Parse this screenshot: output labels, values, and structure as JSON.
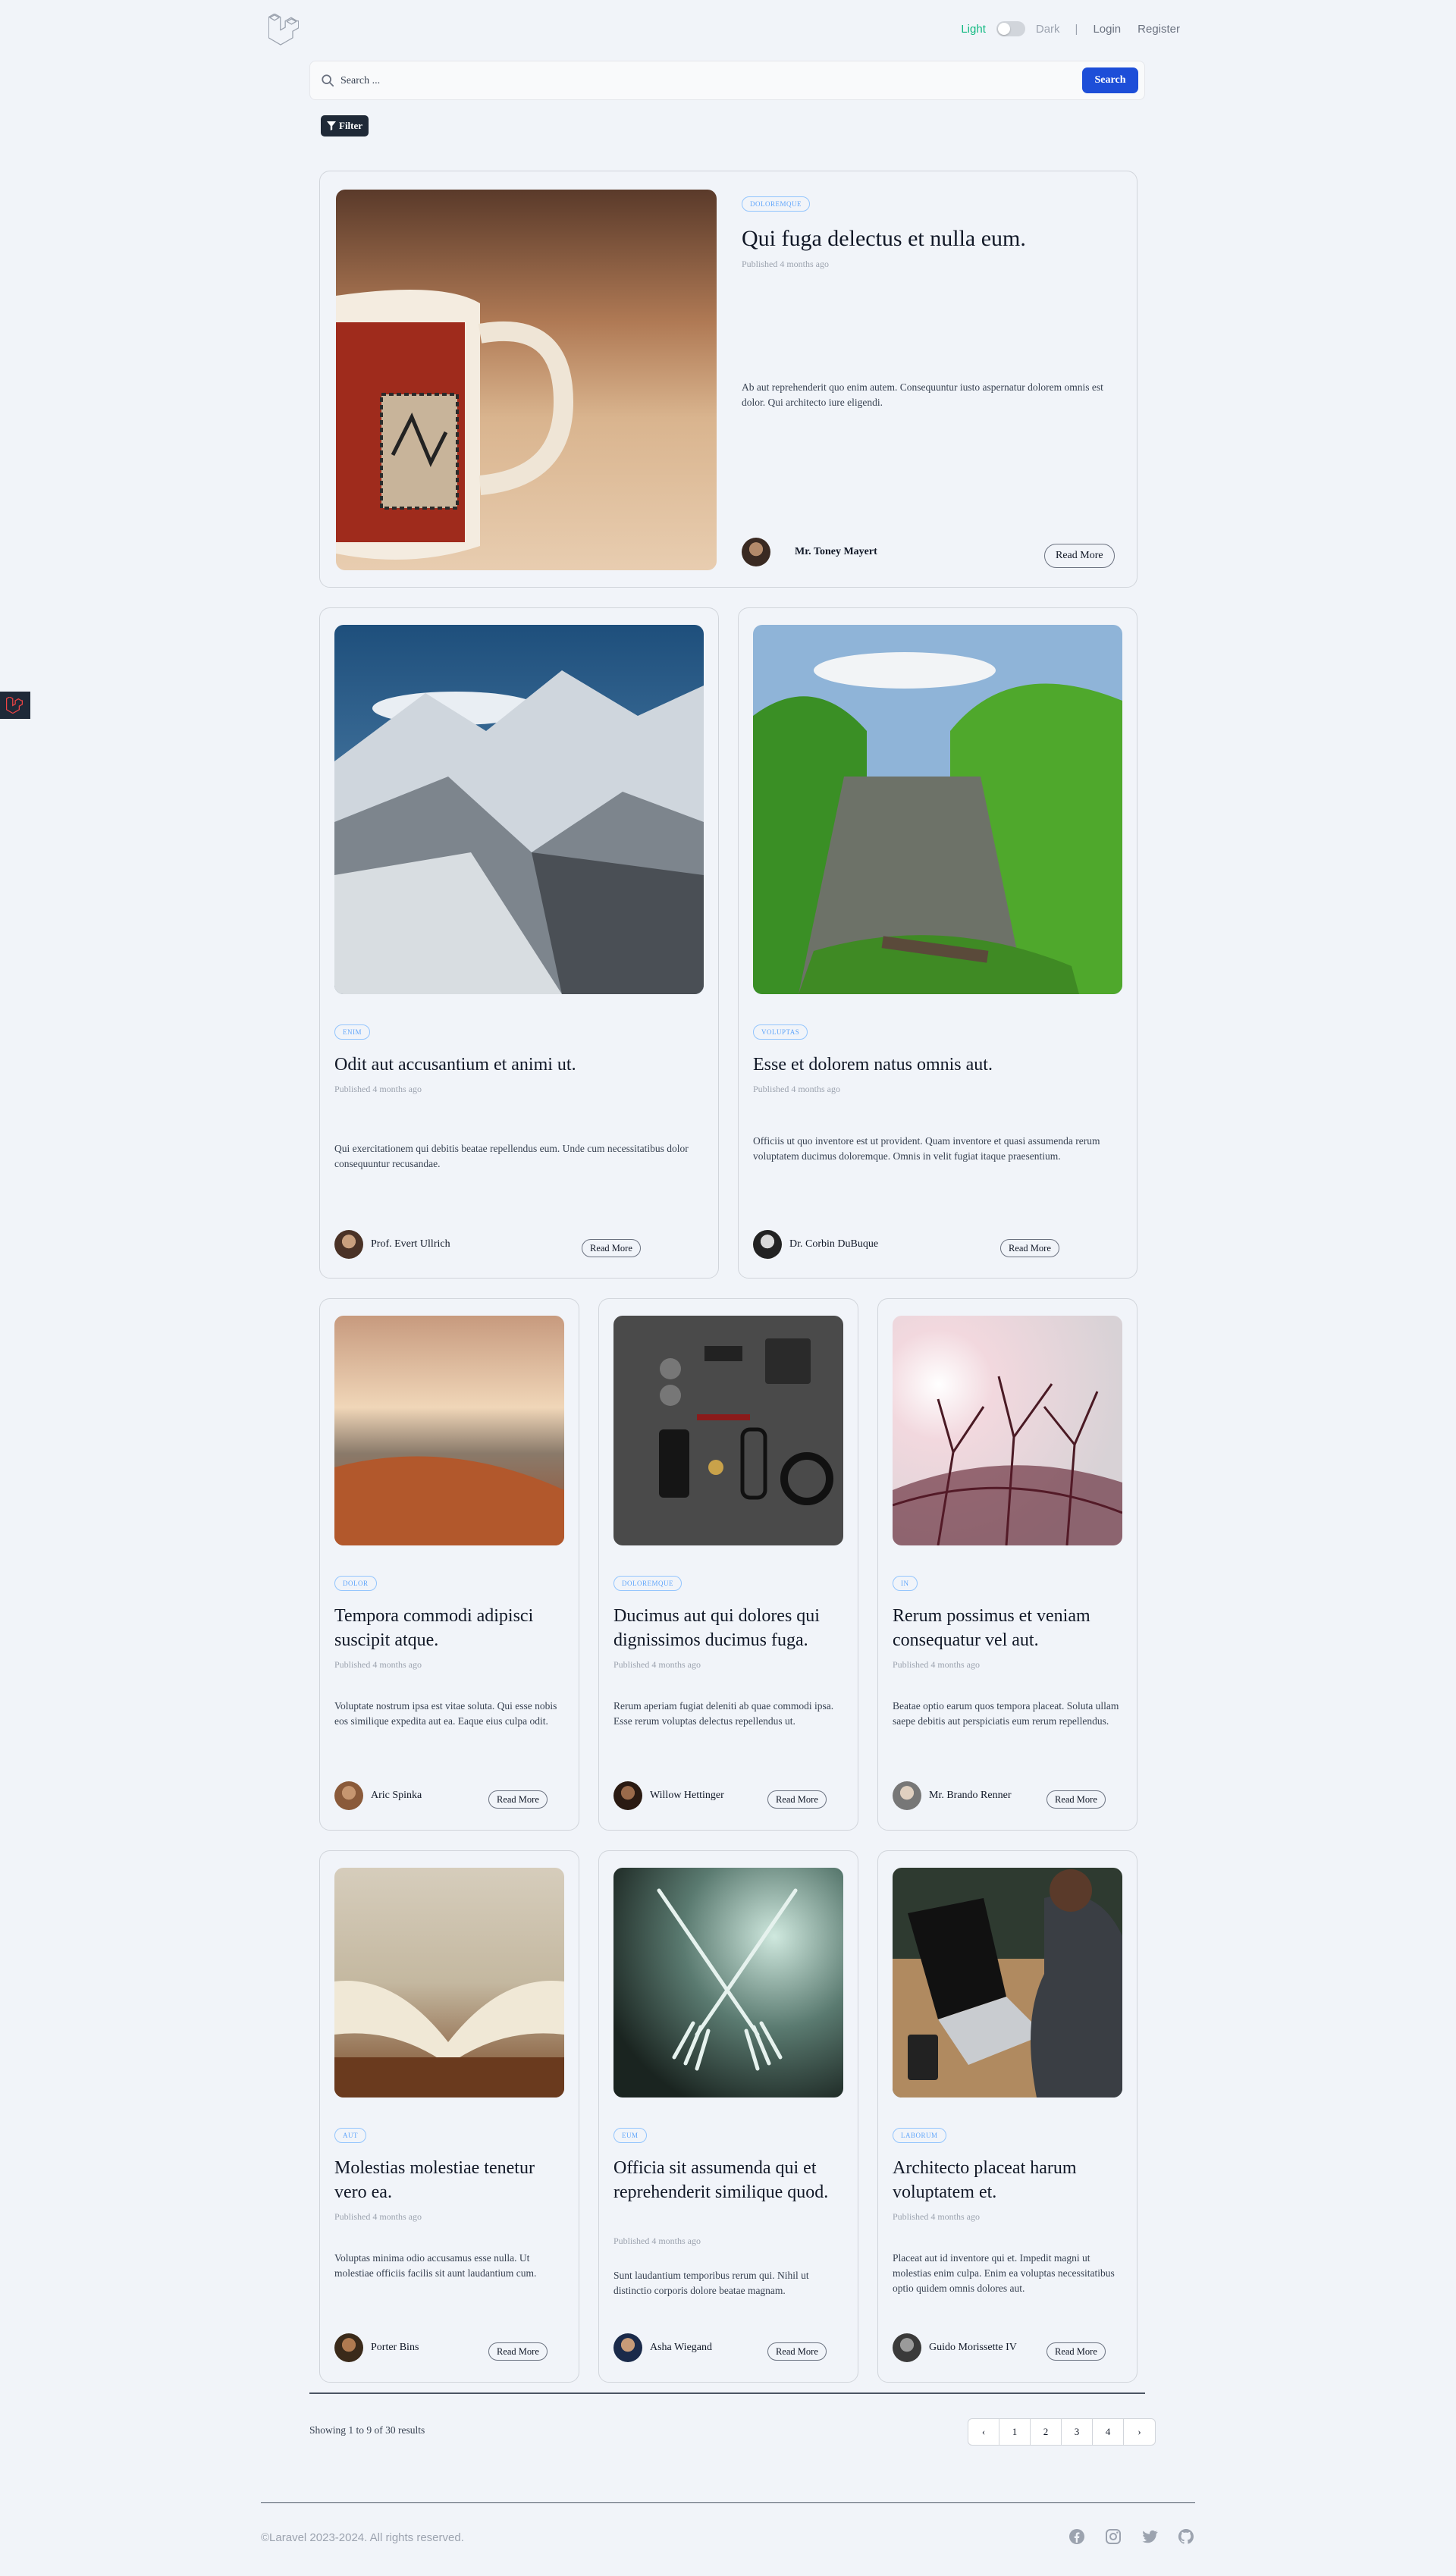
{
  "nav": {
    "light": "Light",
    "dark": "Dark",
    "separator": "|",
    "login": "Login",
    "register": "Register"
  },
  "search": {
    "placeholder": "Search ...",
    "button": "Search"
  },
  "filter": {
    "label": "Filter"
  },
  "posts": [
    {
      "tag": "DOLOREMQUE",
      "title": "Qui fuga delectus et nulla eum.",
      "published": "Published 4 months ago",
      "excerpt": "Ab aut reprehenderit quo enim autem. Consequuntur iusto aspernatur dolorem omnis est dolor. Qui architecto iure eligendi.",
      "author": "Mr. Toney Mayert",
      "read_more": "Read More"
    },
    {
      "tag": "ENIM",
      "title": "Odit aut accusantium et animi ut.",
      "published": "Published 4 months ago",
      "excerpt": "Qui exercitationem qui debitis beatae repellendus eum. Unde cum necessitatibus dolor consequuntur recusandae.",
      "author": "Prof. Evert Ullrich",
      "read_more": "Read More"
    },
    {
      "tag": "VOLUPTAS",
      "title": "Esse et dolorem natus omnis aut.",
      "published": "Published 4 months ago",
      "excerpt": "Officiis ut quo inventore est ut provident. Quam inventore et quasi assumenda rerum voluptatem ducimus doloremque. Omnis in velit fugiat itaque praesentium.",
      "author": "Dr. Corbin DuBuque",
      "read_more": "Read More"
    },
    {
      "tag": "DOLOR",
      "title": "Tempora commodi adipisci suscipit atque.",
      "published": "Published 4 months ago",
      "excerpt": "Voluptate nostrum ipsa est vitae soluta. Qui esse nobis eos similique expedita aut ea. Eaque eius culpa odit.",
      "author": "Aric Spinka",
      "read_more": "Read More"
    },
    {
      "tag": "DOLOREMQUE",
      "title": "Ducimus aut qui dolores qui dignissimos ducimus fuga.",
      "published": "Published 4 months ago",
      "excerpt": "Rerum aperiam fugiat deleniti ab quae commodi ipsa. Esse rerum voluptas delectus repellendus ut.",
      "author": "Willow Hettinger",
      "read_more": "Read More"
    },
    {
      "tag": "IN",
      "title": "Rerum possimus et veniam consequatur vel aut.",
      "published": "Published 4 months ago",
      "excerpt": "Beatae optio earum quos tempora placeat. Soluta ullam saepe debitis aut perspiciatis eum rerum repellendus.",
      "author": "Mr. Brando Renner",
      "read_more": "Read More"
    },
    {
      "tag": "AUT",
      "title": "Molestias molestiae tenetur vero ea.",
      "published": "Published 4 months ago",
      "excerpt": "Voluptas minima odio accusamus esse nulla. Ut molestiae officiis facilis sit aunt laudantium cum.",
      "author": "Porter Bins",
      "read_more": "Read More"
    },
    {
      "tag": "EUM",
      "title": "Officia sit assumenda qui et reprehenderit similique quod.",
      "published": "Published 4 months ago",
      "excerpt": "Sunt laudantium temporibus rerum qui. Nihil ut distinctio corporis dolore beatae magnam.",
      "author": "Asha Wiegand",
      "read_more": "Read More"
    },
    {
      "tag": "LABORUM",
      "title": "Architecto placeat harum voluptatem et.",
      "published": "Published 4 months ago",
      "excerpt": "Placeat aut id inventore qui et. Impedit magni ut molestias enim culpa. Enim ea voluptas necessitatibus optio quidem omnis dolores aut.",
      "author": "Guido Morissette IV",
      "read_more": "Read More"
    }
  ],
  "pagination": {
    "summary": "Showing 1 to 9 of 30 results",
    "prev": "‹",
    "pages": [
      "1",
      "2",
      "3",
      "4"
    ],
    "next": "›"
  },
  "footer": {
    "copyright": "©Laravel 2023-2024. All rights reserved."
  },
  "colors": {
    "accent": "#1d4ed8",
    "light_mode": "#10b981",
    "tag": "#60a5fa",
    "background": "#f1f4f9"
  },
  "icons": [
    "laravel-logo-icon",
    "search-icon",
    "filter-icon",
    "facebook-icon",
    "instagram-icon",
    "twitter-icon",
    "github-icon"
  ]
}
